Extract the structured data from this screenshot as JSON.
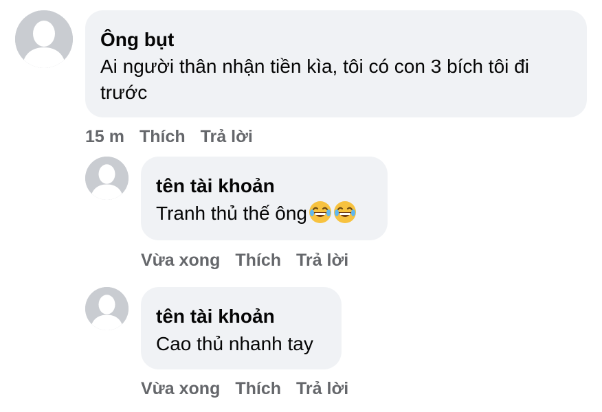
{
  "comments": [
    {
      "author": "Ông bụt",
      "text": "Ai người thân nhận tiền kìa, tôi có con 3 bích tôi đi trước",
      "time": "15 m",
      "like_label": "Thích",
      "reply_label": "Trả lời"
    }
  ],
  "replies": [
    {
      "author": "tên tài khoản",
      "text": "Tranh thủ thế ông",
      "emojis": [
        "face-with-tears-of-joy-icon",
        "face-with-tears-of-joy-icon"
      ],
      "time": "Vừa xong",
      "like_label": "Thích",
      "reply_label": "Trả lời"
    },
    {
      "author": "tên tài khoản",
      "text": "Cao thủ nhanh tay",
      "time": "Vừa xong",
      "like_label": "Thích",
      "reply_label": "Trả lời"
    }
  ],
  "colors": {
    "bubble": "#f0f2f5",
    "meta_text": "#65676b",
    "avatar": "#c9ccd1"
  }
}
